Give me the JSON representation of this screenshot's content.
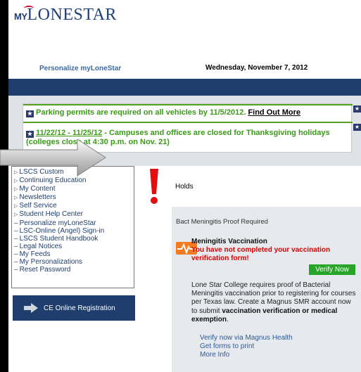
{
  "brand": {
    "prefix": "MY",
    "name": "LONESTAR"
  },
  "header": {
    "personalize": "Personalize myLoneStar",
    "date": "Wednesday, November 7, 2012"
  },
  "announcements": {
    "line1_text": "Parking permits are required on all vehicles by 11/5/2012.",
    "line1_link": "Find Out More",
    "line2_link": "11/22/12 - 11/25/12",
    "line2_text": " - Campuses and offices are closed for Thanksgiving holidays (colleges close at 4:30 p.m. on Nov. 21)"
  },
  "menu": {
    "items": [
      {
        "label": "LSCS Custom",
        "type": "expand"
      },
      {
        "label": "Continuing Education",
        "type": "expand"
      },
      {
        "label": "My Content",
        "type": "expand"
      },
      {
        "label": "Newsletters",
        "type": "expand"
      },
      {
        "label": "Self Service",
        "type": "expand"
      },
      {
        "label": "Student Help Center",
        "type": "expand"
      },
      {
        "label": "Personalize myLoneStar",
        "type": "link"
      },
      {
        "label": "LSC-Online (Angel) Sign-in",
        "type": "link"
      },
      {
        "label": "LSCS Student Handbook",
        "type": "link"
      },
      {
        "label": "Legal Notices",
        "type": "link"
      },
      {
        "label": "My Feeds",
        "type": "link"
      },
      {
        "label": "My Personalizations",
        "type": "link"
      },
      {
        "label": "Reset Password",
        "type": "link"
      }
    ]
  },
  "ce_button": {
    "label": "CE Online Registration"
  },
  "holds": {
    "title": "Holds",
    "item_title": "Bact Meningitis Proof Required",
    "vacc_title": "Meningitis Vaccination",
    "vacc_warning": "You have not completed your vaccination verification form!",
    "verify_button": "Verify Now",
    "desc_part1": "Lone Star College requires proof of Bacterial Meningitis vaccination prior to registering for courses per Texas law. Create a Magnus SMR account now to submit ",
    "desc_bold": "vaccination verification or medical exemption",
    "desc_end": ".",
    "links": [
      "Verify now via Magnus Health",
      "Get forms to print",
      "More Info"
    ]
  },
  "colors": {
    "navy": "#1f3e6d",
    "green": "#3b9a18",
    "red": "#dd0000",
    "verify": "#28a428"
  }
}
